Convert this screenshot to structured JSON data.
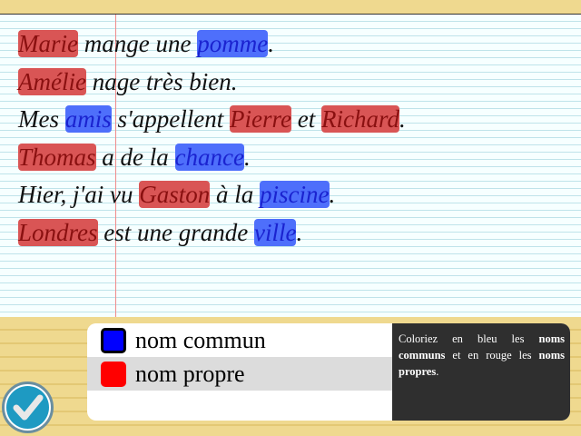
{
  "sentences": [
    [
      {
        "text": "Marie",
        "type": "proper"
      },
      {
        "text": " mange une ",
        "type": "plain"
      },
      {
        "text": "pomme",
        "type": "common"
      },
      {
        "text": ".",
        "type": "plain"
      }
    ],
    [
      {
        "text": "Amélie",
        "type": "proper"
      },
      {
        "text": " nage très bien.",
        "type": "plain"
      }
    ],
    [
      {
        "text": "Mes ",
        "type": "plain"
      },
      {
        "text": "amis",
        "type": "common"
      },
      {
        "text": " s'appellent ",
        "type": "plain"
      },
      {
        "text": "Pierre",
        "type": "proper"
      },
      {
        "text": " et ",
        "type": "plain"
      },
      {
        "text": "Richard",
        "type": "proper"
      },
      {
        "text": ".",
        "type": "plain"
      }
    ],
    [
      {
        "text": "Thomas",
        "type": "proper"
      },
      {
        "text": " a de la ",
        "type": "plain"
      },
      {
        "text": "chance",
        "type": "common"
      },
      {
        "text": ".",
        "type": "plain"
      }
    ],
    [
      {
        "text": "Hier, j'ai vu ",
        "type": "plain"
      },
      {
        "text": "Gaston",
        "type": "proper"
      },
      {
        "text": " à la ",
        "type": "plain"
      },
      {
        "text": "piscine",
        "type": "common"
      },
      {
        "text": ".",
        "type": "plain"
      }
    ],
    [
      {
        "text": "Londres",
        "type": "proper"
      },
      {
        "text": " est une grande ",
        "type": "plain"
      },
      {
        "text": "ville",
        "type": "common"
      },
      {
        "text": ".",
        "type": "plain"
      }
    ]
  ],
  "legend": {
    "common_label": "nom commun",
    "proper_label": "nom propre",
    "common_color": "#0000ff",
    "proper_color": "#ff0000",
    "selected": "common"
  },
  "instructions": {
    "before": "Coloriez en bleu les ",
    "bold1": "noms communs",
    "middle": " et en rouge les ",
    "bold2": "noms propres",
    "after": "."
  },
  "check_button": {
    "icon": "checkmark-icon"
  }
}
